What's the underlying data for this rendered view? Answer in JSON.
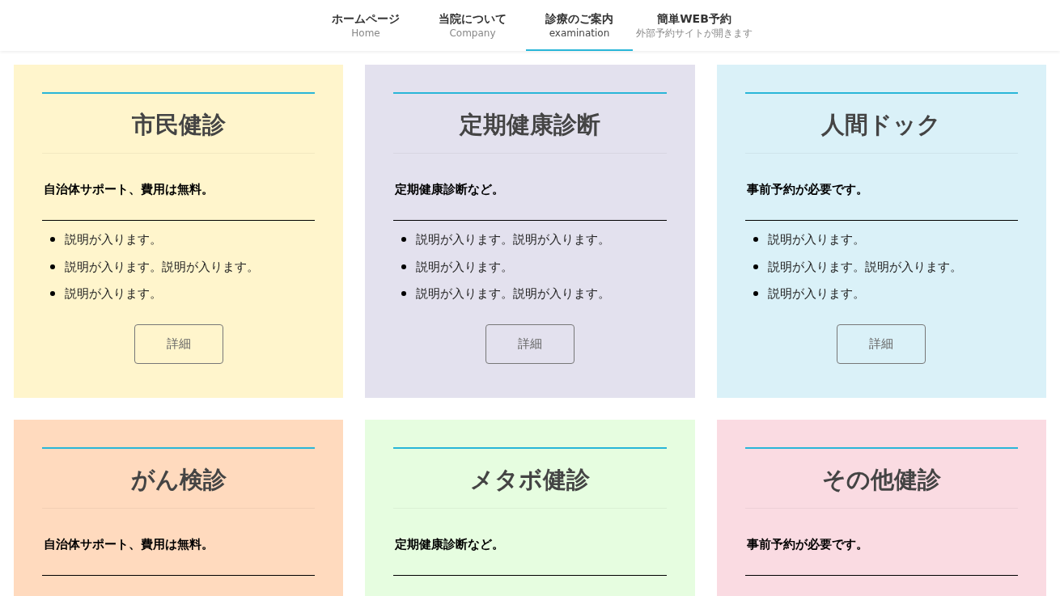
{
  "nav": [
    {
      "label": "ホームページ",
      "sub": "Home",
      "selected": false
    },
    {
      "label": "当院について",
      "sub": "Company",
      "selected": false
    },
    {
      "label": "診療のご案内",
      "sub": "examination",
      "selected": true
    },
    {
      "label": "簡単WEB予約",
      "sub": "外部予約サイトが開きます",
      "selected": false
    }
  ],
  "cards": [
    {
      "title": "市民健診",
      "lead": "自治体サポート、費用は無料。",
      "color": "#fff5cc",
      "items": [
        "説明が入ります。",
        "説明が入ります。説明が入ります。",
        "説明が入ります。"
      ],
      "button": "詳細"
    },
    {
      "title": "定期健康診断",
      "lead": "定期健康診断など。",
      "color": "#e3e1ee",
      "items": [
        "説明が入ります。説明が入ります。",
        "説明が入ります。",
        "説明が入ります。説明が入ります。"
      ],
      "button": "詳細"
    },
    {
      "title": "人間ドック",
      "lead": "事前予約が必要です。",
      "color": "#daf1f8",
      "items": [
        "説明が入ります。",
        "説明が入ります。説明が入ります。",
        "説明が入ります。"
      ],
      "button": "詳細"
    },
    {
      "title": "がん検診",
      "lead": "自治体サポート、費用は無料。",
      "color": "#ffdabe"
    },
    {
      "title": "メタボ健診",
      "lead": "定期健康診断など。",
      "color": "#e6fde0"
    },
    {
      "title": "その他健診",
      "lead": "事前予約が必要です。",
      "color": "#fadbe2"
    }
  ]
}
